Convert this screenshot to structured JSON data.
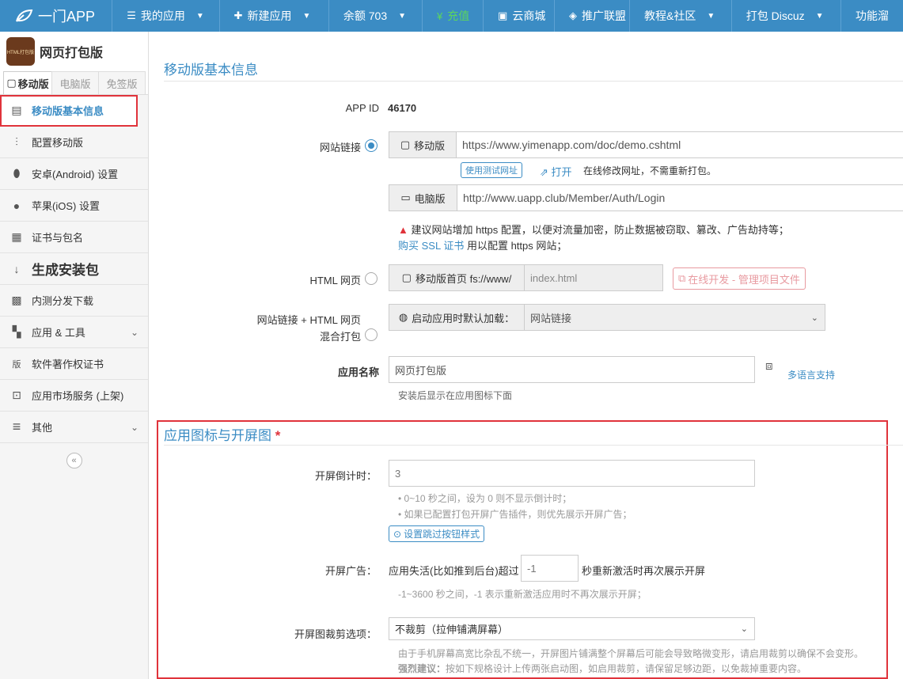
{
  "topnav": {
    "brand": "一门APP",
    "items": [
      {
        "label": "我的应用",
        "icon": "☰",
        "caret": true
      },
      {
        "label": "新建应用",
        "icon": "✚",
        "caret": true
      },
      {
        "label": "余额 703",
        "caret": true
      },
      {
        "label": "充值",
        "icon": "¥"
      },
      {
        "label": "云商城",
        "icon": "▣"
      },
      {
        "label": "推广联盟",
        "icon": "◈"
      },
      {
        "label": "教程&社区",
        "caret": true
      },
      {
        "label": "打包 Discuz",
        "caret": true
      },
      {
        "label": "功能溜"
      }
    ]
  },
  "sidebar": {
    "app_logo_text": "HTML打包版",
    "app_name": "网页打包版",
    "tabs": [
      "移动版",
      "电脑版",
      "免签版"
    ],
    "items": [
      {
        "label": "移动版基本信息",
        "icon": "▤"
      },
      {
        "label": "配置移动版",
        "icon": "⫶"
      },
      {
        "label": "安卓(Android) 设置",
        "icon": "⬮"
      },
      {
        "label": "苹果(iOS) 设置",
        "icon": "●"
      },
      {
        "label": "证书与包名",
        "icon": "▦"
      },
      {
        "label": "生成安装包",
        "icon": "↓"
      },
      {
        "label": "内测分发下载",
        "icon": "▩"
      },
      {
        "label": "应用 & 工具",
        "icon": "▚"
      },
      {
        "label": "软件著作权证书",
        "icon": "版"
      },
      {
        "label": "应用市场服务 (上架)",
        "icon": "⊡"
      },
      {
        "label": "其他",
        "icon": "≡"
      }
    ],
    "collapse": "«"
  },
  "basic": {
    "title": "移动版基本信息",
    "appid_label": "APP ID",
    "appid_value": "46170",
    "site_link_label": "网站链接",
    "mobile_addon": "移动版",
    "mobile_url": "https://www.yimenapp.com/doc/demo.cshtml",
    "test_url_btn": "使用测试网址",
    "open_link": "打开",
    "online_hint": "在线修改网址，不需重新打包。",
    "pc_addon": "电脑版",
    "pc_url": "http://www.uapp.club/Member/Auth/Login",
    "warn_text": "建议网站增加 https 配置，以便对流量加密，防止数据被窃取、篡改、广告劫持等；",
    "ssl_link": "购买 SSL 证书",
    "ssl_text": "用以配置 https 网站；",
    "html_label": "HTML 网页",
    "html_addon": "移动版首页 fs://www/",
    "html_value": "index.html",
    "online_dev_btn": "在线开发 - 管理项目文件",
    "mix_label_1": "网站链接 + HTML 网页",
    "mix_label_2": "混合打包",
    "mix_addon": "启动应用时默认加载：",
    "mix_value": "网站链接",
    "app_name_label": "应用名称",
    "app_name_value": "网页打包版",
    "multi_lang": "多语言支持",
    "app_name_hint": "安装后显示在应用图标下面"
  },
  "splash": {
    "title": "应用图标与开屏图",
    "required_mark": "*",
    "countdown_label": "开屏倒计时：",
    "countdown_value": "3",
    "countdown_hint_1": "• 0~10 秒之间，设为 0 则不显示倒计时；",
    "countdown_hint_2": "• 如果已配置打包开屏广告插件，则优先展示开屏广告；",
    "skip_btn": "设置跳过按钮样式",
    "ad_label": "开屏广告：",
    "ad_prefix": "应用失活(比如推到后台)超过",
    "ad_value": "-1",
    "ad_suffix": "秒重新激活时再次展示开屏",
    "ad_hint": "-1~3600 秒之间，-1 表示重新激活应用时不再次展示开屏；",
    "crop_label": "开屏图裁剪选项：",
    "crop_value": "不裁剪（拉伸铺满屏幕）",
    "crop_hint_1": "由于手机屏幕高宽比杂乱不统一，开屏图片铺满整个屏幕后可能会导致略微变形，请启用裁剪以确保不会变形。",
    "crop_hint_2_bold": "强烈建议：",
    "crop_hint_2": "按如下规格设计上传两张启动图，如启用裁剪，请保留足够边距，以免裁掉重要内容。"
  },
  "colors": {
    "nav": "#3b8cc4",
    "accent": "#3b8cc4",
    "highlight": "#e0333b"
  }
}
